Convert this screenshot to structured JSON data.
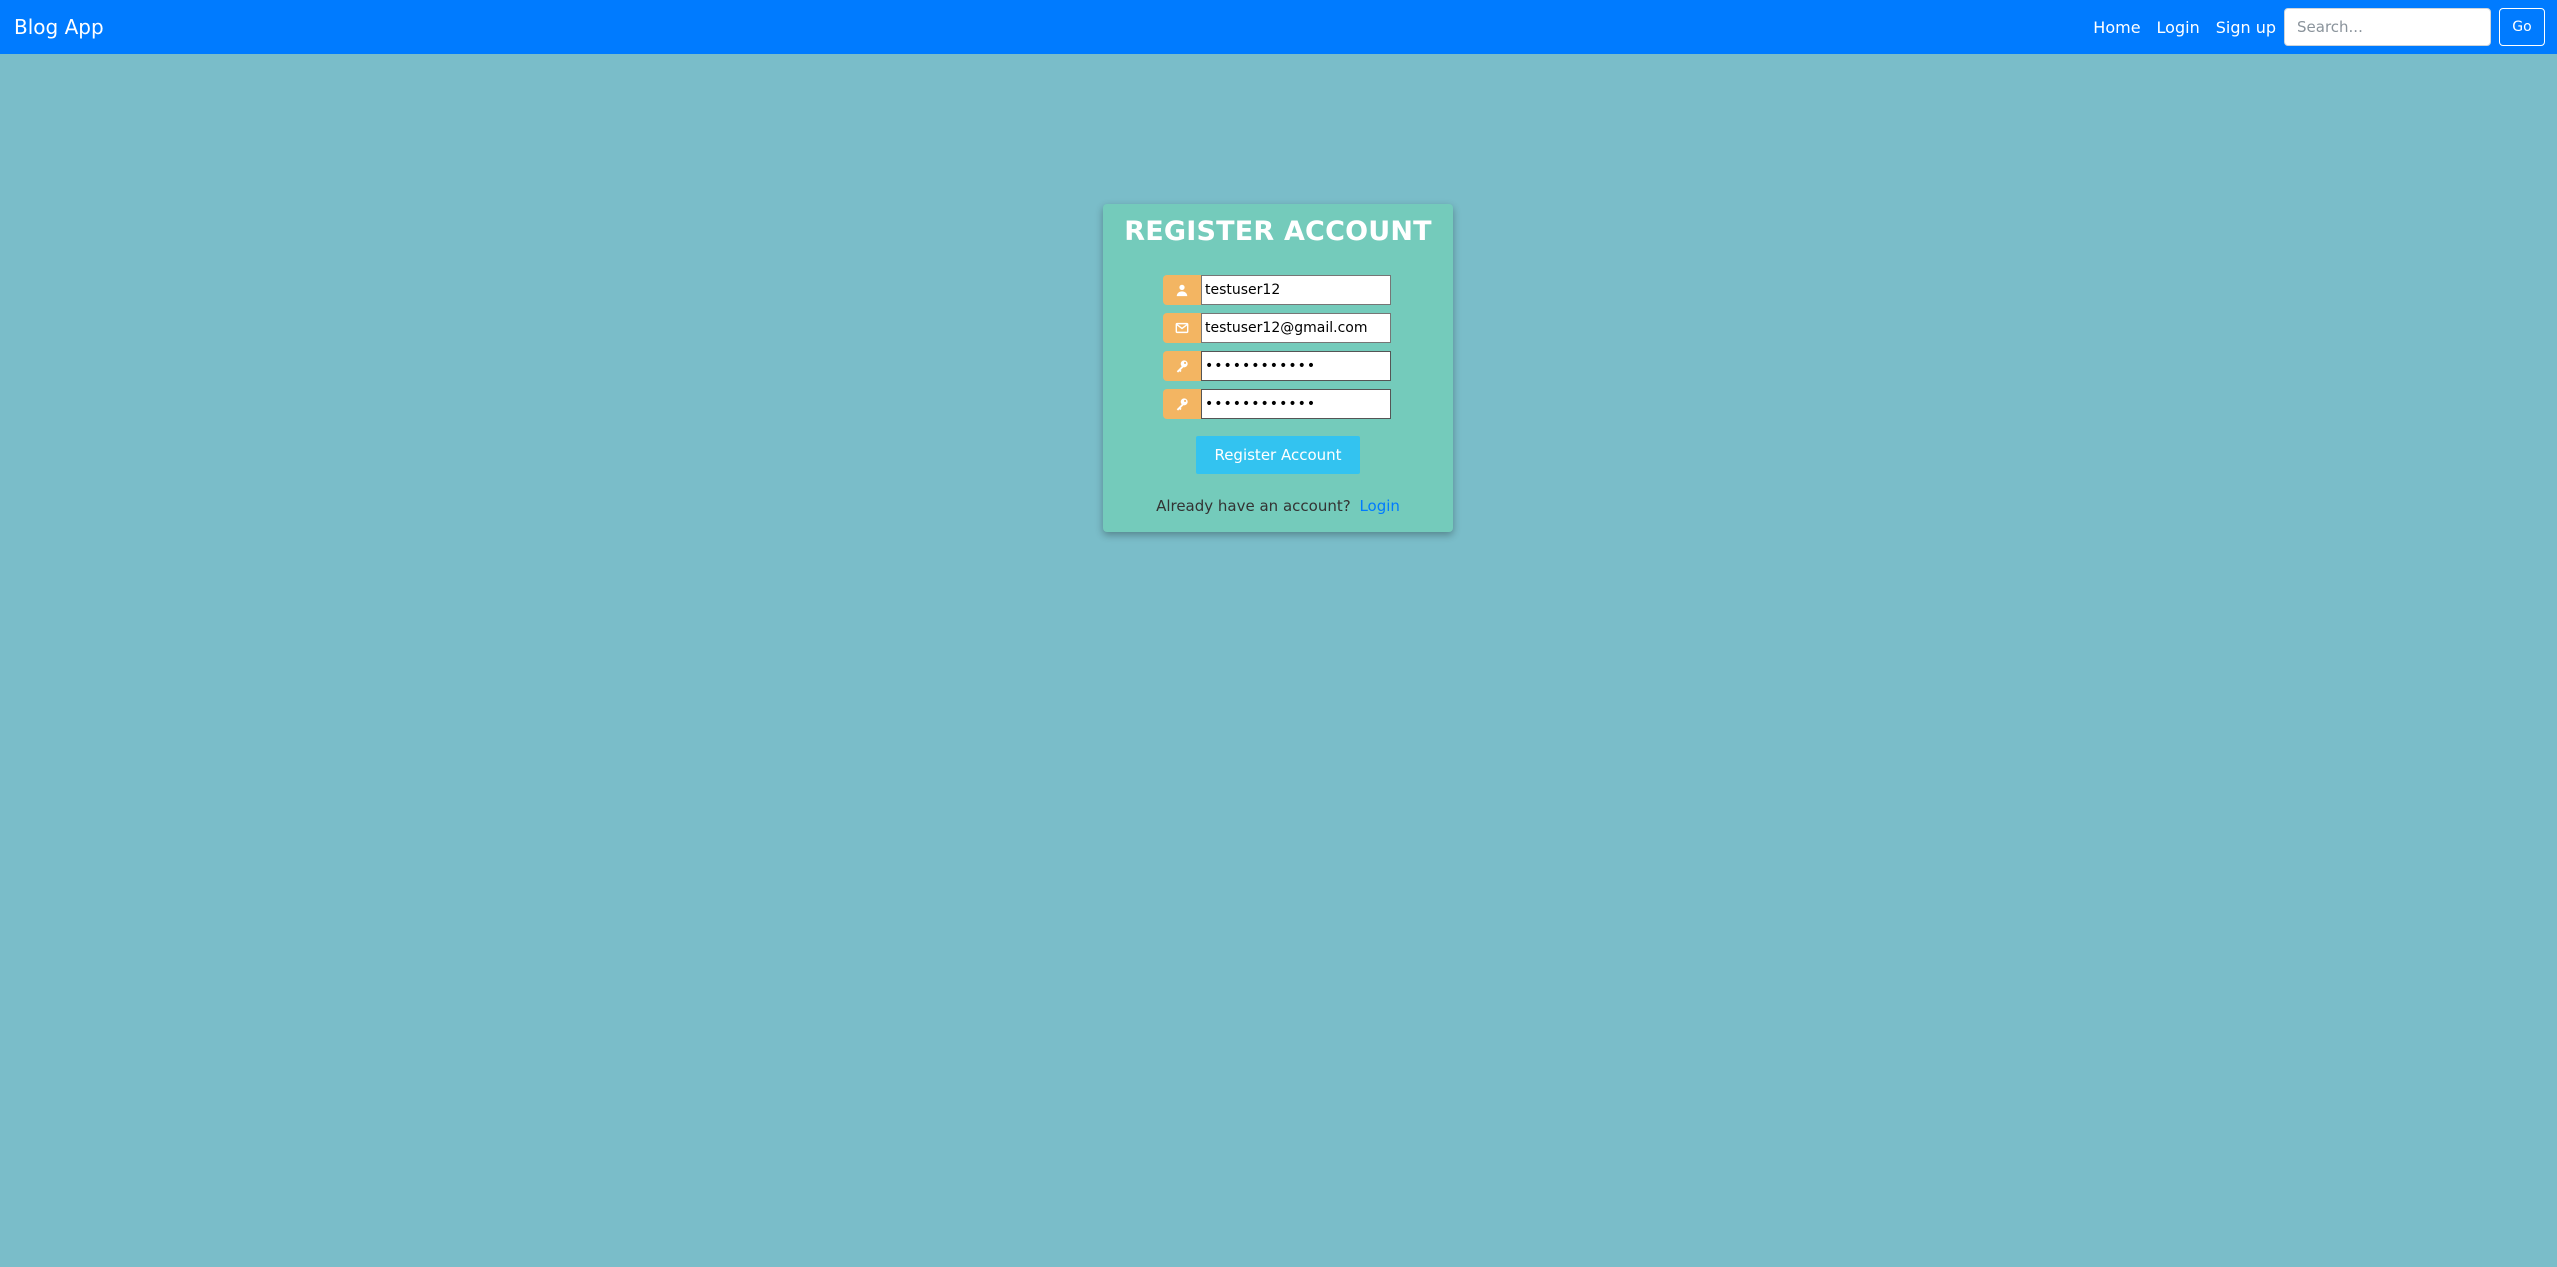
{
  "navbar": {
    "brand": "Blog App",
    "links": [
      "Home",
      "Login",
      "Sign up"
    ],
    "search_placeholder": "Search...",
    "search_value": "",
    "go_label": "Go",
    "color": "#007bff"
  },
  "register_form": {
    "title": "REGISTER ACCOUNT",
    "fields": {
      "username": {
        "icon": "user-icon",
        "value": "testuser12"
      },
      "email": {
        "icon": "envelope-icon",
        "value": "testuser12@gmail.com"
      },
      "password": {
        "icon": "key-icon",
        "value": "testuser1234"
      },
      "confirm_password": {
        "icon": "key-icon",
        "value": "testuser1234"
      }
    },
    "submit_label": "Register Account",
    "login_prompt": "Already have an account?",
    "login_link": "Login",
    "card_color": "#74cbbb",
    "icon_color": "#f3b562",
    "button_color": "#33c3f0"
  },
  "page": {
    "background_color": "#7abdc9"
  }
}
